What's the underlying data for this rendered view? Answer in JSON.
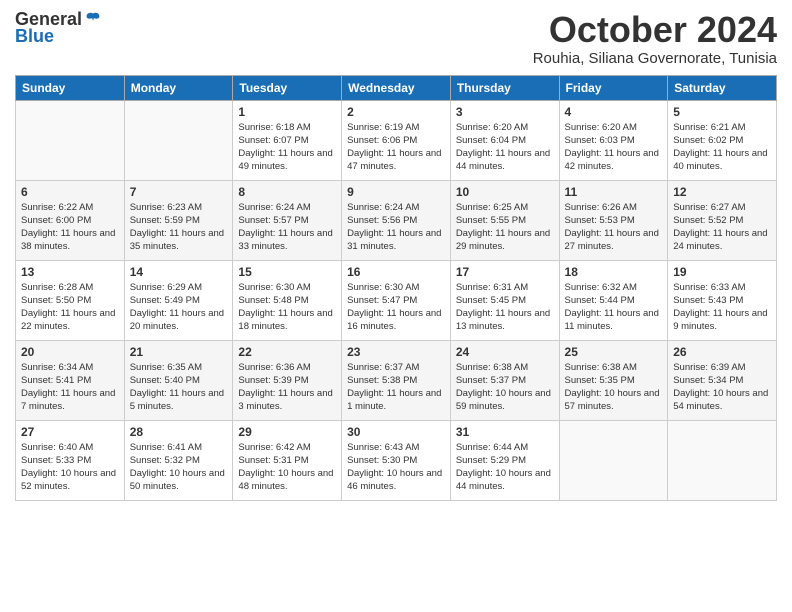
{
  "logo": {
    "general": "General",
    "blue": "Blue"
  },
  "header": {
    "month": "October 2024",
    "location": "Rouhia, Siliana Governorate, Tunisia"
  },
  "days_of_week": [
    "Sunday",
    "Monday",
    "Tuesday",
    "Wednesday",
    "Thursday",
    "Friday",
    "Saturday"
  ],
  "weeks": [
    [
      {
        "day": "",
        "sunrise": "",
        "sunset": "",
        "daylight": ""
      },
      {
        "day": "",
        "sunrise": "",
        "sunset": "",
        "daylight": ""
      },
      {
        "day": "1",
        "sunrise": "Sunrise: 6:18 AM",
        "sunset": "Sunset: 6:07 PM",
        "daylight": "Daylight: 11 hours and 49 minutes."
      },
      {
        "day": "2",
        "sunrise": "Sunrise: 6:19 AM",
        "sunset": "Sunset: 6:06 PM",
        "daylight": "Daylight: 11 hours and 47 minutes."
      },
      {
        "day": "3",
        "sunrise": "Sunrise: 6:20 AM",
        "sunset": "Sunset: 6:04 PM",
        "daylight": "Daylight: 11 hours and 44 minutes."
      },
      {
        "day": "4",
        "sunrise": "Sunrise: 6:20 AM",
        "sunset": "Sunset: 6:03 PM",
        "daylight": "Daylight: 11 hours and 42 minutes."
      },
      {
        "day": "5",
        "sunrise": "Sunrise: 6:21 AM",
        "sunset": "Sunset: 6:02 PM",
        "daylight": "Daylight: 11 hours and 40 minutes."
      }
    ],
    [
      {
        "day": "6",
        "sunrise": "Sunrise: 6:22 AM",
        "sunset": "Sunset: 6:00 PM",
        "daylight": "Daylight: 11 hours and 38 minutes."
      },
      {
        "day": "7",
        "sunrise": "Sunrise: 6:23 AM",
        "sunset": "Sunset: 5:59 PM",
        "daylight": "Daylight: 11 hours and 35 minutes."
      },
      {
        "day": "8",
        "sunrise": "Sunrise: 6:24 AM",
        "sunset": "Sunset: 5:57 PM",
        "daylight": "Daylight: 11 hours and 33 minutes."
      },
      {
        "day": "9",
        "sunrise": "Sunrise: 6:24 AM",
        "sunset": "Sunset: 5:56 PM",
        "daylight": "Daylight: 11 hours and 31 minutes."
      },
      {
        "day": "10",
        "sunrise": "Sunrise: 6:25 AM",
        "sunset": "Sunset: 5:55 PM",
        "daylight": "Daylight: 11 hours and 29 minutes."
      },
      {
        "day": "11",
        "sunrise": "Sunrise: 6:26 AM",
        "sunset": "Sunset: 5:53 PM",
        "daylight": "Daylight: 11 hours and 27 minutes."
      },
      {
        "day": "12",
        "sunrise": "Sunrise: 6:27 AM",
        "sunset": "Sunset: 5:52 PM",
        "daylight": "Daylight: 11 hours and 24 minutes."
      }
    ],
    [
      {
        "day": "13",
        "sunrise": "Sunrise: 6:28 AM",
        "sunset": "Sunset: 5:50 PM",
        "daylight": "Daylight: 11 hours and 22 minutes."
      },
      {
        "day": "14",
        "sunrise": "Sunrise: 6:29 AM",
        "sunset": "Sunset: 5:49 PM",
        "daylight": "Daylight: 11 hours and 20 minutes."
      },
      {
        "day": "15",
        "sunrise": "Sunrise: 6:30 AM",
        "sunset": "Sunset: 5:48 PM",
        "daylight": "Daylight: 11 hours and 18 minutes."
      },
      {
        "day": "16",
        "sunrise": "Sunrise: 6:30 AM",
        "sunset": "Sunset: 5:47 PM",
        "daylight": "Daylight: 11 hours and 16 minutes."
      },
      {
        "day": "17",
        "sunrise": "Sunrise: 6:31 AM",
        "sunset": "Sunset: 5:45 PM",
        "daylight": "Daylight: 11 hours and 13 minutes."
      },
      {
        "day": "18",
        "sunrise": "Sunrise: 6:32 AM",
        "sunset": "Sunset: 5:44 PM",
        "daylight": "Daylight: 11 hours and 11 minutes."
      },
      {
        "day": "19",
        "sunrise": "Sunrise: 6:33 AM",
        "sunset": "Sunset: 5:43 PM",
        "daylight": "Daylight: 11 hours and 9 minutes."
      }
    ],
    [
      {
        "day": "20",
        "sunrise": "Sunrise: 6:34 AM",
        "sunset": "Sunset: 5:41 PM",
        "daylight": "Daylight: 11 hours and 7 minutes."
      },
      {
        "day": "21",
        "sunrise": "Sunrise: 6:35 AM",
        "sunset": "Sunset: 5:40 PM",
        "daylight": "Daylight: 11 hours and 5 minutes."
      },
      {
        "day": "22",
        "sunrise": "Sunrise: 6:36 AM",
        "sunset": "Sunset: 5:39 PM",
        "daylight": "Daylight: 11 hours and 3 minutes."
      },
      {
        "day": "23",
        "sunrise": "Sunrise: 6:37 AM",
        "sunset": "Sunset: 5:38 PM",
        "daylight": "Daylight: 11 hours and 1 minute."
      },
      {
        "day": "24",
        "sunrise": "Sunrise: 6:38 AM",
        "sunset": "Sunset: 5:37 PM",
        "daylight": "Daylight: 10 hours and 59 minutes."
      },
      {
        "day": "25",
        "sunrise": "Sunrise: 6:38 AM",
        "sunset": "Sunset: 5:35 PM",
        "daylight": "Daylight: 10 hours and 57 minutes."
      },
      {
        "day": "26",
        "sunrise": "Sunrise: 6:39 AM",
        "sunset": "Sunset: 5:34 PM",
        "daylight": "Daylight: 10 hours and 54 minutes."
      }
    ],
    [
      {
        "day": "27",
        "sunrise": "Sunrise: 6:40 AM",
        "sunset": "Sunset: 5:33 PM",
        "daylight": "Daylight: 10 hours and 52 minutes."
      },
      {
        "day": "28",
        "sunrise": "Sunrise: 6:41 AM",
        "sunset": "Sunset: 5:32 PM",
        "daylight": "Daylight: 10 hours and 50 minutes."
      },
      {
        "day": "29",
        "sunrise": "Sunrise: 6:42 AM",
        "sunset": "Sunset: 5:31 PM",
        "daylight": "Daylight: 10 hours and 48 minutes."
      },
      {
        "day": "30",
        "sunrise": "Sunrise: 6:43 AM",
        "sunset": "Sunset: 5:30 PM",
        "daylight": "Daylight: 10 hours and 46 minutes."
      },
      {
        "day": "31",
        "sunrise": "Sunrise: 6:44 AM",
        "sunset": "Sunset: 5:29 PM",
        "daylight": "Daylight: 10 hours and 44 minutes."
      },
      {
        "day": "",
        "sunrise": "",
        "sunset": "",
        "daylight": ""
      },
      {
        "day": "",
        "sunrise": "",
        "sunset": "",
        "daylight": ""
      }
    ]
  ]
}
